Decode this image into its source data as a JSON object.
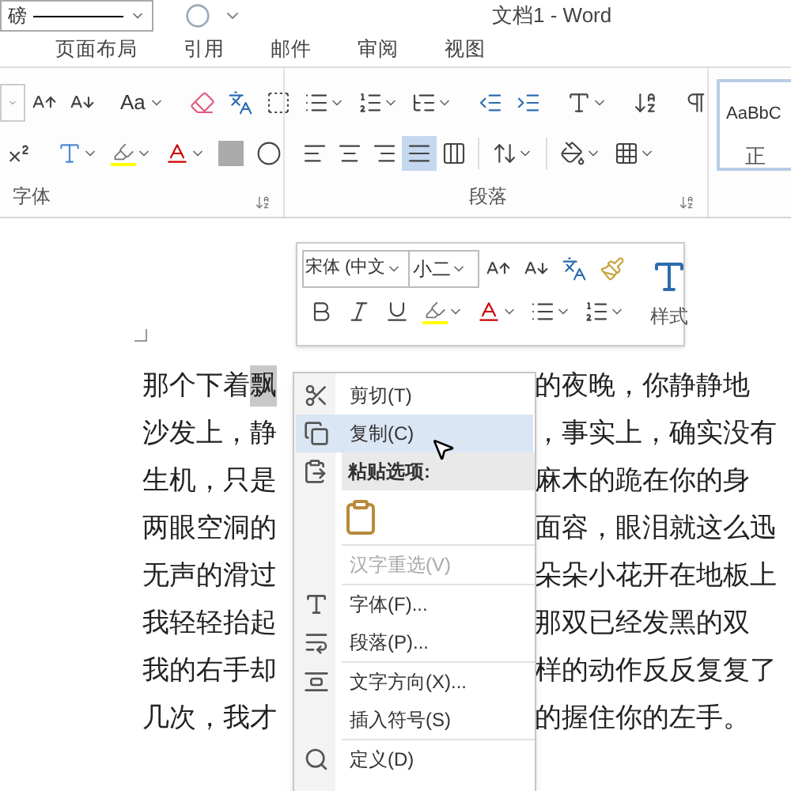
{
  "title_bar": {
    "border_field": "磅",
    "title": "文档1 - Word"
  },
  "tabs": [
    {
      "label": "页面布局",
      "selected": false
    },
    {
      "label": "引用",
      "selected": false
    },
    {
      "label": "邮件",
      "selected": false
    },
    {
      "label": "审阅",
      "selected": false
    },
    {
      "label": "视图",
      "selected": false
    }
  ],
  "ribbon": {
    "font_group": {
      "label": "字体",
      "case_button": "Aa"
    },
    "paragraph_group": {
      "label": "段落",
      "align_buttons": [
        {
          "kind": "left",
          "selected": false
        },
        {
          "kind": "center",
          "selected": false
        },
        {
          "kind": "right",
          "selected": false
        },
        {
          "kind": "justify",
          "selected": true
        },
        {
          "kind": "distributed",
          "selected": false
        }
      ]
    },
    "styles": {
      "preview": "AaBbC",
      "name": "正"
    }
  },
  "mini_toolbar": {
    "font": "宋体 (中文",
    "size": "小二",
    "styles_label": "样式"
  },
  "document": {
    "lines": [
      {
        "left": "那个下着",
        "selection": "飘",
        "right": "的夜晚，你静静地"
      },
      {
        "left": "沙发上，静",
        "right": "，事实上，确实没有"
      },
      {
        "left": "生机，只是",
        "right": "麻木的跪在你的身"
      },
      {
        "left": "两眼空洞的",
        "right": "面容，眼泪就这么迅"
      },
      {
        "left": "无声的滑过",
        "right": "朵朵小花开在地板上"
      },
      {
        "left": "我轻轻抬起",
        "right": "那双已经发黑的双"
      },
      {
        "left": "我的右手却",
        "right": "样的动作反反复复了"
      },
      {
        "left": "几次，我才",
        "right": "的握住你的左手。"
      }
    ]
  },
  "context_menu": {
    "items": [
      {
        "kind": "command",
        "label": "剪切(T)",
        "highlighted": false,
        "disabled": false
      },
      {
        "kind": "command",
        "label": "复制(C)",
        "highlighted": true,
        "disabled": false
      },
      {
        "kind": "header",
        "label": "粘贴选项:"
      },
      {
        "kind": "paste_options"
      },
      {
        "kind": "separator"
      },
      {
        "kind": "command",
        "label": "汉字重选(V)",
        "highlighted": false,
        "disabled": true
      },
      {
        "kind": "separator"
      },
      {
        "kind": "command",
        "label": "字体(F)...",
        "highlighted": false,
        "disabled": false
      },
      {
        "kind": "command",
        "label": "段落(P)...",
        "highlighted": false,
        "disabled": false
      },
      {
        "kind": "separator"
      },
      {
        "kind": "command",
        "label": "文字方向(X)...",
        "highlighted": false,
        "disabled": false
      },
      {
        "kind": "command",
        "label": "插入符号(S)",
        "highlighted": false,
        "disabled": false
      },
      {
        "kind": "separator"
      },
      {
        "kind": "command",
        "label": "定义(D)",
        "highlighted": false,
        "disabled": false
      }
    ]
  }
}
